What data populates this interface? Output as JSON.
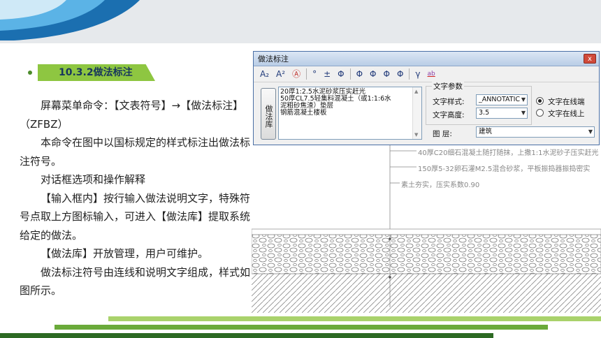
{
  "section": {
    "number_title": "10.3.2做法标注"
  },
  "body": {
    "p1": "屏幕菜单命令：【文表符号】→【做法标注】（ZFBZ）",
    "p2": "本命令在图中以国标规定的样式标注出做法标注符号。",
    "p3": "对话框选项和操作解释",
    "p4": "【输入框内】按行输入做法说明文字，特殊符号点取上方图标输入，可进入【做法库】提取系统给定的做法。",
    "p5": "【做法库】开放管理，用户可维护。",
    "p6": "做法标注符号由连线和说明文字组成，样式如图所示。"
  },
  "dialog": {
    "title": "做法标注",
    "close_label": "x",
    "toolbar": [
      "A₂",
      "A²",
      "Ⓐ",
      "°",
      "±",
      "Φ",
      "Φ",
      "Φ",
      "Φ",
      "Φ",
      "γ",
      "ab"
    ],
    "library_button": "做法库",
    "lines": [
      "20厚1:2.5水泥砂浆压实赶光",
      "50厚CL7.5轻集料混凝土（或1:1:6水",
      "泥粗砂焦渣）垫层",
      "钢筋混凝土楼板"
    ],
    "params_title": "文字参数",
    "style_label": "文字样式:",
    "style_value": "_ANNOTATIC",
    "height_label": "文字高度:",
    "height_value": "3.5",
    "layer_label": "图    层:",
    "layer_value": "建筑",
    "radio_on_line": "文字在线端",
    "radio_above_line": "文字在线上"
  },
  "drawing": {
    "note1": "40厚C20细石混凝土随打随抹，上撒1:1水泥砂子压实赶光",
    "note2": "150厚5-32卵石灌M2.5混合砂浆，平板振捣器振捣密实",
    "note3": "素土夯实，压实系数0.90"
  },
  "colors": {
    "accent_green": "#8ec641",
    "dark_green": "#2d6a23",
    "title_blue": "#17365d"
  }
}
